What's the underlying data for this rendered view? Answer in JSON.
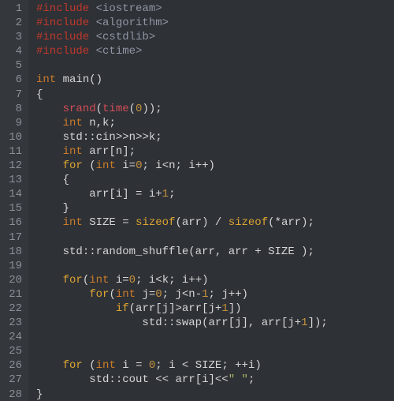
{
  "lines": [
    {
      "n": 1,
      "tokens": [
        [
          "inc",
          "#include "
        ],
        [
          "hdr",
          "<iostream>"
        ]
      ]
    },
    {
      "n": 2,
      "tokens": [
        [
          "inc",
          "#include "
        ],
        [
          "hdr",
          "<algorithm>"
        ]
      ]
    },
    {
      "n": 3,
      "tokens": [
        [
          "inc",
          "#include "
        ],
        [
          "hdr",
          "<cstdlib>"
        ]
      ]
    },
    {
      "n": 4,
      "tokens": [
        [
          "inc",
          "#include "
        ],
        [
          "hdr",
          "<ctime>"
        ]
      ]
    },
    {
      "n": 5,
      "tokens": [
        [
          "id",
          ""
        ]
      ]
    },
    {
      "n": 6,
      "tokens": [
        [
          "type",
          "int "
        ],
        [
          "id",
          "main"
        ],
        [
          "op",
          "()"
        ]
      ]
    },
    {
      "n": 7,
      "tokens": [
        [
          "op",
          "{"
        ]
      ]
    },
    {
      "n": 8,
      "tokens": [
        [
          "id",
          "    "
        ],
        [
          "fn",
          "srand"
        ],
        [
          "op",
          "("
        ],
        [
          "fn",
          "time"
        ],
        [
          "op",
          "("
        ],
        [
          "num",
          "0"
        ],
        [
          "op",
          "));"
        ]
      ]
    },
    {
      "n": 9,
      "tokens": [
        [
          "id",
          "    "
        ],
        [
          "type",
          "int "
        ],
        [
          "id",
          "n"
        ],
        [
          "op",
          ","
        ],
        [
          "id",
          "k"
        ],
        [
          "op",
          ";"
        ]
      ]
    },
    {
      "n": 10,
      "tokens": [
        [
          "id",
          "    std"
        ],
        [
          "op",
          "::"
        ],
        [
          "id",
          "cin"
        ],
        [
          "op",
          ">>"
        ],
        [
          "id",
          "n"
        ],
        [
          "op",
          ">>"
        ],
        [
          "id",
          "k"
        ],
        [
          "op",
          ";"
        ]
      ]
    },
    {
      "n": 11,
      "tokens": [
        [
          "id",
          "    "
        ],
        [
          "type",
          "int "
        ],
        [
          "id",
          "arr"
        ],
        [
          "op",
          "["
        ],
        [
          "id",
          "n"
        ],
        [
          "op",
          "];"
        ]
      ]
    },
    {
      "n": 12,
      "tokens": [
        [
          "id",
          "    "
        ],
        [
          "kw",
          "for"
        ],
        [
          "op",
          " ("
        ],
        [
          "type",
          "int "
        ],
        [
          "id",
          "i"
        ],
        [
          "op",
          "="
        ],
        [
          "num",
          "0"
        ],
        [
          "op",
          "; "
        ],
        [
          "id",
          "i"
        ],
        [
          "op",
          "<"
        ],
        [
          "id",
          "n"
        ],
        [
          "op",
          "; "
        ],
        [
          "id",
          "i"
        ],
        [
          "op",
          "++)"
        ]
      ]
    },
    {
      "n": 13,
      "tokens": [
        [
          "op",
          "    {"
        ]
      ]
    },
    {
      "n": 14,
      "tokens": [
        [
          "id",
          "        arr"
        ],
        [
          "op",
          "["
        ],
        [
          "id",
          "i"
        ],
        [
          "op",
          "] = "
        ],
        [
          "id",
          "i"
        ],
        [
          "op",
          "+"
        ],
        [
          "num",
          "1"
        ],
        [
          "op",
          ";"
        ]
      ]
    },
    {
      "n": 15,
      "tokens": [
        [
          "op",
          "    }"
        ]
      ]
    },
    {
      "n": 16,
      "tokens": [
        [
          "id",
          "    "
        ],
        [
          "type",
          "int "
        ],
        [
          "id",
          "SIZE "
        ],
        [
          "op",
          "= "
        ],
        [
          "kw",
          "sizeof"
        ],
        [
          "op",
          "("
        ],
        [
          "id",
          "arr"
        ],
        [
          "op",
          ") / "
        ],
        [
          "kw",
          "sizeof"
        ],
        [
          "op",
          "(*"
        ],
        [
          "id",
          "arr"
        ],
        [
          "op",
          ");"
        ]
      ]
    },
    {
      "n": 17,
      "tokens": [
        [
          "id",
          ""
        ]
      ]
    },
    {
      "n": 18,
      "tokens": [
        [
          "id",
          "    std"
        ],
        [
          "op",
          "::"
        ],
        [
          "id",
          "random_shuffle"
        ],
        [
          "op",
          "("
        ],
        [
          "id",
          "arr"
        ],
        [
          "op",
          ", "
        ],
        [
          "id",
          "arr "
        ],
        [
          "op",
          "+ "
        ],
        [
          "id",
          "SIZE "
        ],
        [
          "op",
          ");"
        ]
      ]
    },
    {
      "n": 19,
      "tokens": [
        [
          "id",
          ""
        ]
      ]
    },
    {
      "n": 20,
      "tokens": [
        [
          "id",
          "    "
        ],
        [
          "kw",
          "for"
        ],
        [
          "op",
          "("
        ],
        [
          "type",
          "int "
        ],
        [
          "id",
          "i"
        ],
        [
          "op",
          "="
        ],
        [
          "num",
          "0"
        ],
        [
          "op",
          "; "
        ],
        [
          "id",
          "i"
        ],
        [
          "op",
          "<"
        ],
        [
          "id",
          "k"
        ],
        [
          "op",
          "; "
        ],
        [
          "id",
          "i"
        ],
        [
          "op",
          "++)"
        ]
      ]
    },
    {
      "n": 21,
      "tokens": [
        [
          "id",
          "        "
        ],
        [
          "kw",
          "for"
        ],
        [
          "op",
          "("
        ],
        [
          "type",
          "int "
        ],
        [
          "id",
          "j"
        ],
        [
          "op",
          "="
        ],
        [
          "num",
          "0"
        ],
        [
          "op",
          "; "
        ],
        [
          "id",
          "j"
        ],
        [
          "op",
          "<"
        ],
        [
          "id",
          "n"
        ],
        [
          "op",
          "-"
        ],
        [
          "num",
          "1"
        ],
        [
          "op",
          "; "
        ],
        [
          "id",
          "j"
        ],
        [
          "op",
          "++)"
        ]
      ]
    },
    {
      "n": 22,
      "tokens": [
        [
          "id",
          "            "
        ],
        [
          "kw",
          "if"
        ],
        [
          "op",
          "("
        ],
        [
          "id",
          "arr"
        ],
        [
          "op",
          "["
        ],
        [
          "id",
          "j"
        ],
        [
          "op",
          "]>"
        ],
        [
          "id",
          "arr"
        ],
        [
          "op",
          "["
        ],
        [
          "id",
          "j"
        ],
        [
          "op",
          "+"
        ],
        [
          "num",
          "1"
        ],
        [
          "op",
          "])"
        ]
      ]
    },
    {
      "n": 23,
      "tokens": [
        [
          "id",
          "                std"
        ],
        [
          "op",
          "::"
        ],
        [
          "id",
          "swap"
        ],
        [
          "op",
          "("
        ],
        [
          "id",
          "arr"
        ],
        [
          "op",
          "["
        ],
        [
          "id",
          "j"
        ],
        [
          "op",
          "], "
        ],
        [
          "id",
          "arr"
        ],
        [
          "op",
          "["
        ],
        [
          "id",
          "j"
        ],
        [
          "op",
          "+"
        ],
        [
          "num",
          "1"
        ],
        [
          "op",
          "]);"
        ]
      ]
    },
    {
      "n": 24,
      "tokens": [
        [
          "id",
          ""
        ]
      ]
    },
    {
      "n": 25,
      "tokens": [
        [
          "id",
          ""
        ]
      ]
    },
    {
      "n": 26,
      "tokens": [
        [
          "id",
          "    "
        ],
        [
          "kw",
          "for"
        ],
        [
          "op",
          " ("
        ],
        [
          "type",
          "int "
        ],
        [
          "id",
          "i "
        ],
        [
          "op",
          "= "
        ],
        [
          "num",
          "0"
        ],
        [
          "op",
          "; "
        ],
        [
          "id",
          "i "
        ],
        [
          "op",
          "< "
        ],
        [
          "id",
          "SIZE"
        ],
        [
          "op",
          "; ++"
        ],
        [
          "id",
          "i"
        ],
        [
          "op",
          ")"
        ]
      ]
    },
    {
      "n": 27,
      "tokens": [
        [
          "id",
          "        std"
        ],
        [
          "op",
          "::"
        ],
        [
          "id",
          "cout "
        ],
        [
          "op",
          "<< "
        ],
        [
          "id",
          "arr"
        ],
        [
          "op",
          "["
        ],
        [
          "id",
          "i"
        ],
        [
          "op",
          "]"
        ],
        [
          "op",
          "<<"
        ],
        [
          "str",
          "\" \""
        ],
        [
          "op",
          ";"
        ]
      ]
    },
    {
      "n": 28,
      "tokens": [
        [
          "op",
          "}"
        ]
      ]
    }
  ]
}
